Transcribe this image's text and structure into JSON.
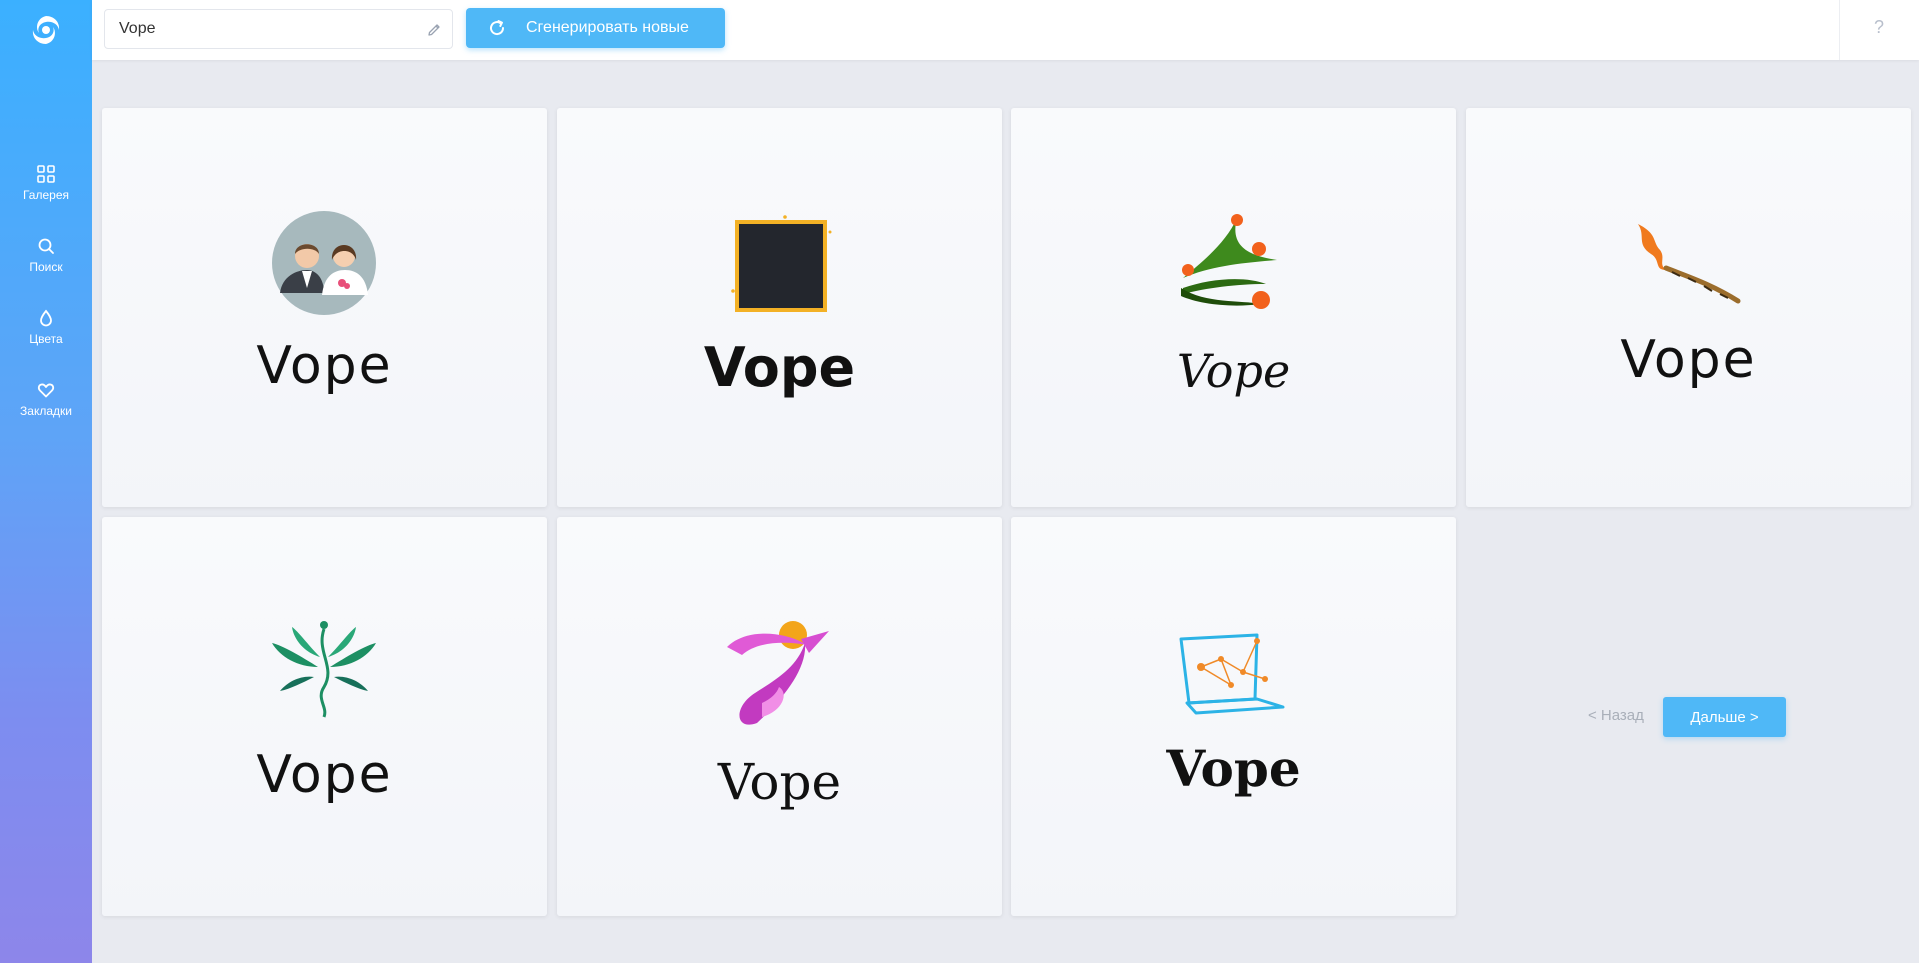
{
  "sidebar": {
    "items": [
      {
        "label": "Галерея",
        "icon": "grid-icon"
      },
      {
        "label": "Поиск",
        "icon": "search-icon"
      },
      {
        "label": "Цвета",
        "icon": "drop-icon"
      },
      {
        "label": "Закладки",
        "icon": "heart-icon"
      }
    ]
  },
  "header": {
    "name_value": "Vope",
    "generate_label": "Сгенерировать новые",
    "help_label": "?"
  },
  "logos": [
    {
      "text": "Vope",
      "icon": "wedding-couple-icon"
    },
    {
      "text": "Vope",
      "icon": "dark-square-icon"
    },
    {
      "text": "Vope",
      "icon": "christmas-tree-icon"
    },
    {
      "text": "Vope",
      "icon": "flame-brush-icon"
    },
    {
      "text": "Vope",
      "icon": "leaf-woman-icon"
    },
    {
      "text": "Vope",
      "icon": "ribbon-figure-icon"
    },
    {
      "text": "Vope",
      "icon": "laptop-network-icon"
    }
  ],
  "pagination": {
    "prev_label": "< Назад",
    "next_label": "Дальше >"
  },
  "colors": {
    "accent": "#4fb8f7",
    "sidebar_top": "#3bb0ff",
    "sidebar_bottom": "#8d86ea"
  }
}
